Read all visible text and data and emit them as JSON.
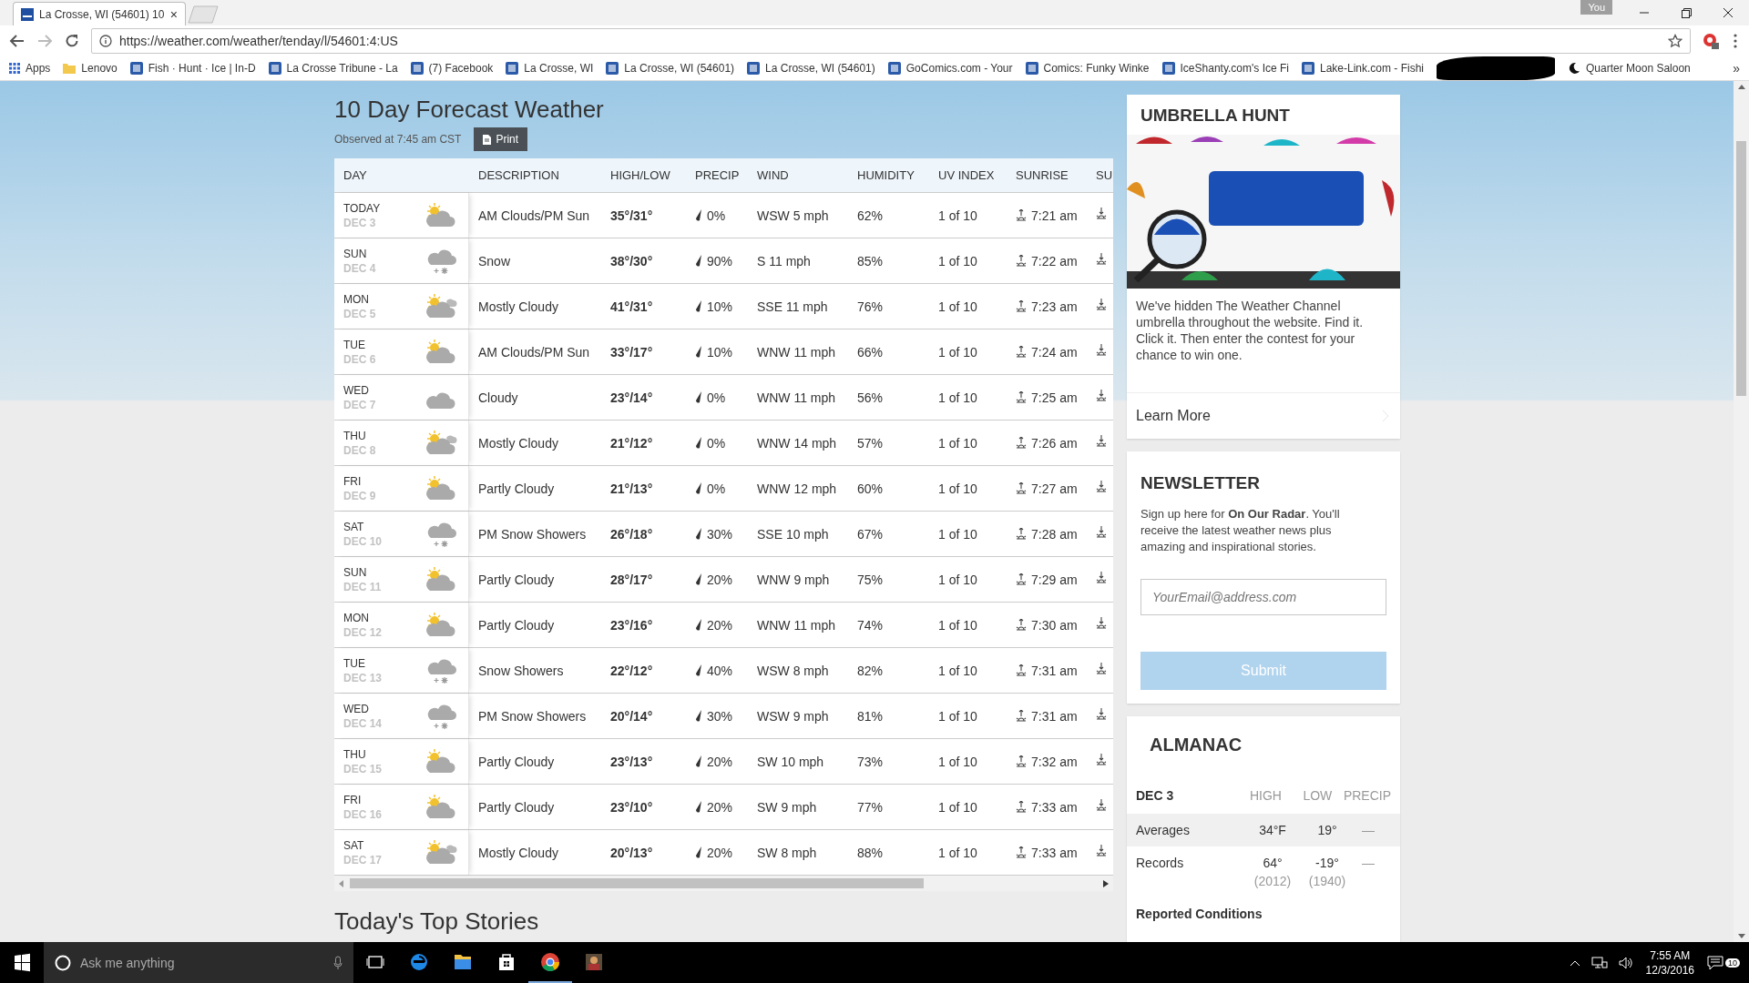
{
  "browser": {
    "tab": {
      "title": "La Crosse, WI (54601) 10",
      "close": "×"
    },
    "profile": "You",
    "url": "https://weather.com/weather/tenday/l/54601:4:US",
    "bookmarks": [
      {
        "kind": "apps",
        "label": "Apps"
      },
      {
        "kind": "folder",
        "label": "Lenovo"
      },
      {
        "kind": "page",
        "label": "Fish · Hunt · Ice | In-D"
      },
      {
        "kind": "page",
        "label": "La Crosse Tribune - La"
      },
      {
        "kind": "page",
        "label": "(7) Facebook"
      },
      {
        "kind": "page",
        "label": "La Crosse, WI"
      },
      {
        "kind": "page",
        "label": "La Crosse, WI (54601)"
      },
      {
        "kind": "page",
        "label": "La Crosse, WI (54601)"
      },
      {
        "kind": "page",
        "label": "GoComics.com - Your"
      },
      {
        "kind": "page",
        "label": "Comics: Funky Winke"
      },
      {
        "kind": "page",
        "label": "IceShanty.com's Ice Fi"
      },
      {
        "kind": "page",
        "label": "Lake-Link.com - Fishi"
      },
      {
        "kind": "redacted"
      },
      {
        "kind": "moon",
        "label": "Quarter Moon Saloon"
      }
    ],
    "overflow": "»"
  },
  "forecast": {
    "title": "10 Day Forecast Weather",
    "observed": "Observed at 7:45 am CST",
    "print": "Print",
    "columns": [
      "DAY",
      "DESCRIPTION",
      "HIGH/LOW",
      "PRECIP",
      "WIND",
      "HUMIDITY",
      "UV INDEX",
      "SUNRISE",
      "SU"
    ],
    "rows": [
      {
        "day": "TODAY",
        "date": "DEC 3",
        "kind": "partly",
        "description": "AM Clouds/PM Sun",
        "hilo": "35°/31°",
        "precip": "0%",
        "wind": "WSW 5 mph",
        "humidity": "62%",
        "uv": "1 of 10",
        "sunrise": "7:21 am"
      },
      {
        "day": "SUN",
        "date": "DEC 4",
        "kind": "snow",
        "description": "Snow",
        "hilo": "38°/30°",
        "precip": "90%",
        "wind": "S 11 mph",
        "humidity": "85%",
        "uv": "1 of 10",
        "sunrise": "7:22 am"
      },
      {
        "day": "MON",
        "date": "DEC 5",
        "kind": "mostly",
        "description": "Mostly Cloudy",
        "hilo": "41°/31°",
        "precip": "10%",
        "wind": "SSE 11 mph",
        "humidity": "76%",
        "uv": "1 of 10",
        "sunrise": "7:23 am"
      },
      {
        "day": "TUE",
        "date": "DEC 6",
        "kind": "partly",
        "description": "AM Clouds/PM Sun",
        "hilo": "33°/17°",
        "precip": "10%",
        "wind": "WNW 11 mph",
        "humidity": "66%",
        "uv": "1 of 10",
        "sunrise": "7:24 am"
      },
      {
        "day": "WED",
        "date": "DEC 7",
        "kind": "cloudy",
        "description": "Cloudy",
        "hilo": "23°/14°",
        "precip": "0%",
        "wind": "WNW 11 mph",
        "humidity": "56%",
        "uv": "1 of 10",
        "sunrise": "7:25 am"
      },
      {
        "day": "THU",
        "date": "DEC 8",
        "kind": "mostly",
        "description": "Mostly Cloudy",
        "hilo": "21°/12°",
        "precip": "0%",
        "wind": "WNW 14 mph",
        "humidity": "57%",
        "uv": "1 of 10",
        "sunrise": "7:26 am"
      },
      {
        "day": "FRI",
        "date": "DEC 9",
        "kind": "partly",
        "description": "Partly Cloudy",
        "hilo": "21°/13°",
        "precip": "0%",
        "wind": "WNW 12 mph",
        "humidity": "60%",
        "uv": "1 of 10",
        "sunrise": "7:27 am"
      },
      {
        "day": "SAT",
        "date": "DEC 10",
        "kind": "snow",
        "description": "PM Snow Showers",
        "hilo": "26°/18°",
        "precip": "30%",
        "wind": "SSE 10 mph",
        "humidity": "67%",
        "uv": "1 of 10",
        "sunrise": "7:28 am"
      },
      {
        "day": "SUN",
        "date": "DEC 11",
        "kind": "partly",
        "description": "Partly Cloudy",
        "hilo": "28°/17°",
        "precip": "20%",
        "wind": "WNW 9 mph",
        "humidity": "75%",
        "uv": "1 of 10",
        "sunrise": "7:29 am"
      },
      {
        "day": "MON",
        "date": "DEC 12",
        "kind": "partly",
        "description": "Partly Cloudy",
        "hilo": "23°/16°",
        "precip": "20%",
        "wind": "WNW 11 mph",
        "humidity": "74%",
        "uv": "1 of 10",
        "sunrise": "7:30 am"
      },
      {
        "day": "TUE",
        "date": "DEC 13",
        "kind": "snow",
        "description": "Snow Showers",
        "hilo": "22°/12°",
        "precip": "40%",
        "wind": "WSW 8 mph",
        "humidity": "82%",
        "uv": "1 of 10",
        "sunrise": "7:31 am"
      },
      {
        "day": "WED",
        "date": "DEC 14",
        "kind": "snow",
        "description": "PM Snow Showers",
        "hilo": "20°/14°",
        "precip": "30%",
        "wind": "WSW 9 mph",
        "humidity": "81%",
        "uv": "1 of 10",
        "sunrise": "7:31 am"
      },
      {
        "day": "THU",
        "date": "DEC 15",
        "kind": "partly",
        "description": "Partly Cloudy",
        "hilo": "23°/13°",
        "precip": "20%",
        "wind": "SW 10 mph",
        "humidity": "73%",
        "uv": "1 of 10",
        "sunrise": "7:32 am"
      },
      {
        "day": "FRI",
        "date": "DEC 16",
        "kind": "partly",
        "description": "Partly Cloudy",
        "hilo": "23°/10°",
        "precip": "20%",
        "wind": "SW 9 mph",
        "humidity": "77%",
        "uv": "1 of 10",
        "sunrise": "7:33 am"
      },
      {
        "day": "SAT",
        "date": "DEC 17",
        "kind": "mostly",
        "description": "Mostly Cloudy",
        "hilo": "20°/13°",
        "precip": "20%",
        "wind": "SW 8 mph",
        "humidity": "88%",
        "uv": "1 of 10",
        "sunrise": "7:33 am"
      }
    ],
    "stories_title": "Today's Top Stories"
  },
  "umbrella_hunt": {
    "title": "UMBRELLA HUNT",
    "text": "We've hidden The Weather Channel umbrella throughout the website. Find it. Click it. Then enter the contest for your chance to win one.",
    "link": "Learn More"
  },
  "newsletter": {
    "title": "NEWSLETTER",
    "text": "Sign up here for **On Our Radar**. You'll receive the latest weather news plus amazing and inspirational stories.",
    "placeholder": "YourEmail@address.com",
    "submit": "Submit"
  },
  "almanac": {
    "title": "ALMANAC",
    "date": "DEC 3",
    "columns": [
      "HIGH",
      "LOW",
      "PRECIP"
    ],
    "rows": [
      {
        "label": "Averages",
        "high": "34°F",
        "low": "19°",
        "precip": "—"
      },
      {
        "label": "Records",
        "high": "64°",
        "high_year": "(2012)",
        "low": "-19°",
        "low_year": "(1940)",
        "precip": "—"
      }
    ],
    "reported": "Reported Conditions"
  },
  "taskbar": {
    "search": "Ask me anything",
    "time": "7:55 AM",
    "date": "12/3/2016",
    "notifications": "10"
  }
}
